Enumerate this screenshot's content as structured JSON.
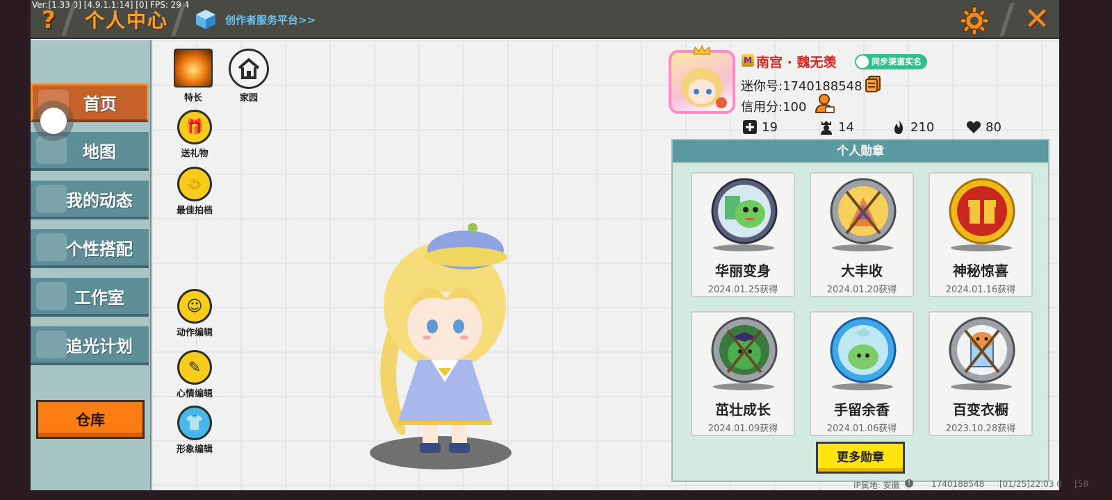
{
  "debug": {
    "version_text": "Ver:[1.33.0] [4.9.1.1:14] [0]  FPS: 29.4"
  },
  "header": {
    "title": "个人中心",
    "creator_link": "创作者服务平台>>",
    "help_glyph": "?",
    "close_glyph": "✕",
    "icons": [
      "help-icon",
      "cube-icon",
      "gear-icon",
      "close-icon"
    ]
  },
  "sidebar": {
    "items": [
      {
        "label": "首页",
        "active": true
      },
      {
        "label": "地图",
        "active": false
      },
      {
        "label": "我的动态",
        "active": false
      },
      {
        "label": "个性搭配",
        "active": false
      },
      {
        "label": "工作室",
        "active": false
      },
      {
        "label": "追光计划",
        "active": false
      }
    ],
    "warehouse_label": "仓库"
  },
  "actions": {
    "specialty": "特长",
    "home": "家园",
    "send_gift": "送礼物",
    "best_partner": "最佳拍档",
    "motion_edit": "动作编辑",
    "mood_edit": "心情编辑",
    "image_edit": "形象编辑"
  },
  "profile": {
    "nickname": "南宫 · 魏无羡",
    "verify_label": "同步渠道实名",
    "mini_id": "迷你号:1740188548",
    "credit": "信用分:100",
    "stats": {
      "plus": "19",
      "followers": "14",
      "fire": "210",
      "likes": "80"
    }
  },
  "medals": {
    "header": "个人勋章",
    "items": [
      {
        "name": "华丽变身",
        "date": "2024.01.25获得"
      },
      {
        "name": "大丰收",
        "date": "2024.01.20获得"
      },
      {
        "name": "神秘惊喜",
        "date": "2024.01.16获得"
      },
      {
        "name": "茁壮成长",
        "date": "2024.01.09获得"
      },
      {
        "name": "手留余香",
        "date": "2024.01.06获得"
      },
      {
        "name": "百变衣橱",
        "date": "2023.10.28获得"
      }
    ],
    "more_label": "更多勋章"
  },
  "footer": {
    "ip_location": "IP属地: 安徽",
    "uid": "1740188548",
    "time": "[01/25]22:03 0",
    "extra": "[58"
  },
  "colors": {
    "accent_orange": "#f28a1c",
    "sidebar_active": "#c5612a",
    "sidebar_item": "#5e8f98",
    "medal_header": "#5b9aa0",
    "button_yellow": "#ffe410",
    "nickname_red": "#d8241c",
    "verify_green": "#2dbf8f"
  }
}
